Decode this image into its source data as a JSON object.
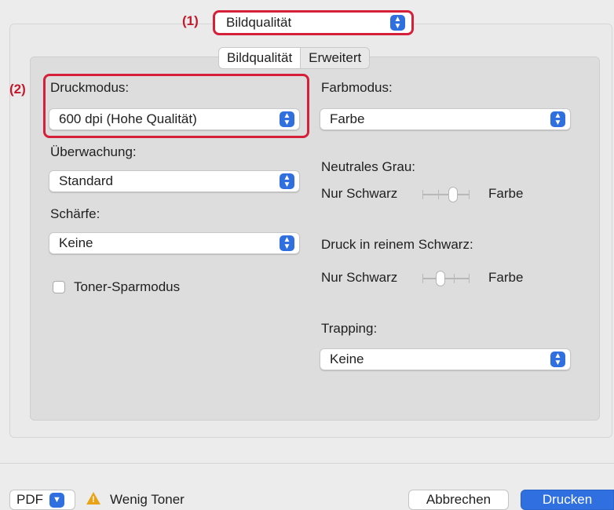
{
  "annotations": {
    "one": "(1)",
    "two": "(2)"
  },
  "panel_select": {
    "value": "Bildqualität"
  },
  "tabs": [
    {
      "label": "Bildqualität",
      "active": true
    },
    {
      "label": "Erweitert",
      "active": false
    }
  ],
  "left": {
    "druckmodus": {
      "label": "Druckmodus:",
      "value": "600 dpi (Hohe Qualität)"
    },
    "ueberwachung": {
      "label": "Überwachung:",
      "value": "Standard"
    },
    "schaerfe": {
      "label": "Schärfe:",
      "value": "Keine"
    },
    "toner_spar": {
      "label": "Toner-Sparmodus",
      "checked": false
    }
  },
  "right": {
    "farbmodus": {
      "label": "Farbmodus:",
      "value": "Farbe"
    },
    "neutrales_grau": {
      "label": "Neutrales Grau:",
      "left": "Nur Schwarz",
      "right": "Farbe",
      "position": "center"
    },
    "reinem_schwarz": {
      "label": "Druck in reinem Schwarz:",
      "left": "Nur Schwarz",
      "right": "Farbe",
      "position": "left"
    },
    "trapping": {
      "label": "Trapping:",
      "value": "Keine"
    }
  },
  "footer": {
    "pdf_label": "PDF",
    "warning": "Wenig Toner",
    "cancel": "Abbrechen",
    "print": "Drucken"
  },
  "colors": {
    "accent": "#2f6fe0",
    "highlight": "#d6203a",
    "warning": "#e8a317"
  }
}
